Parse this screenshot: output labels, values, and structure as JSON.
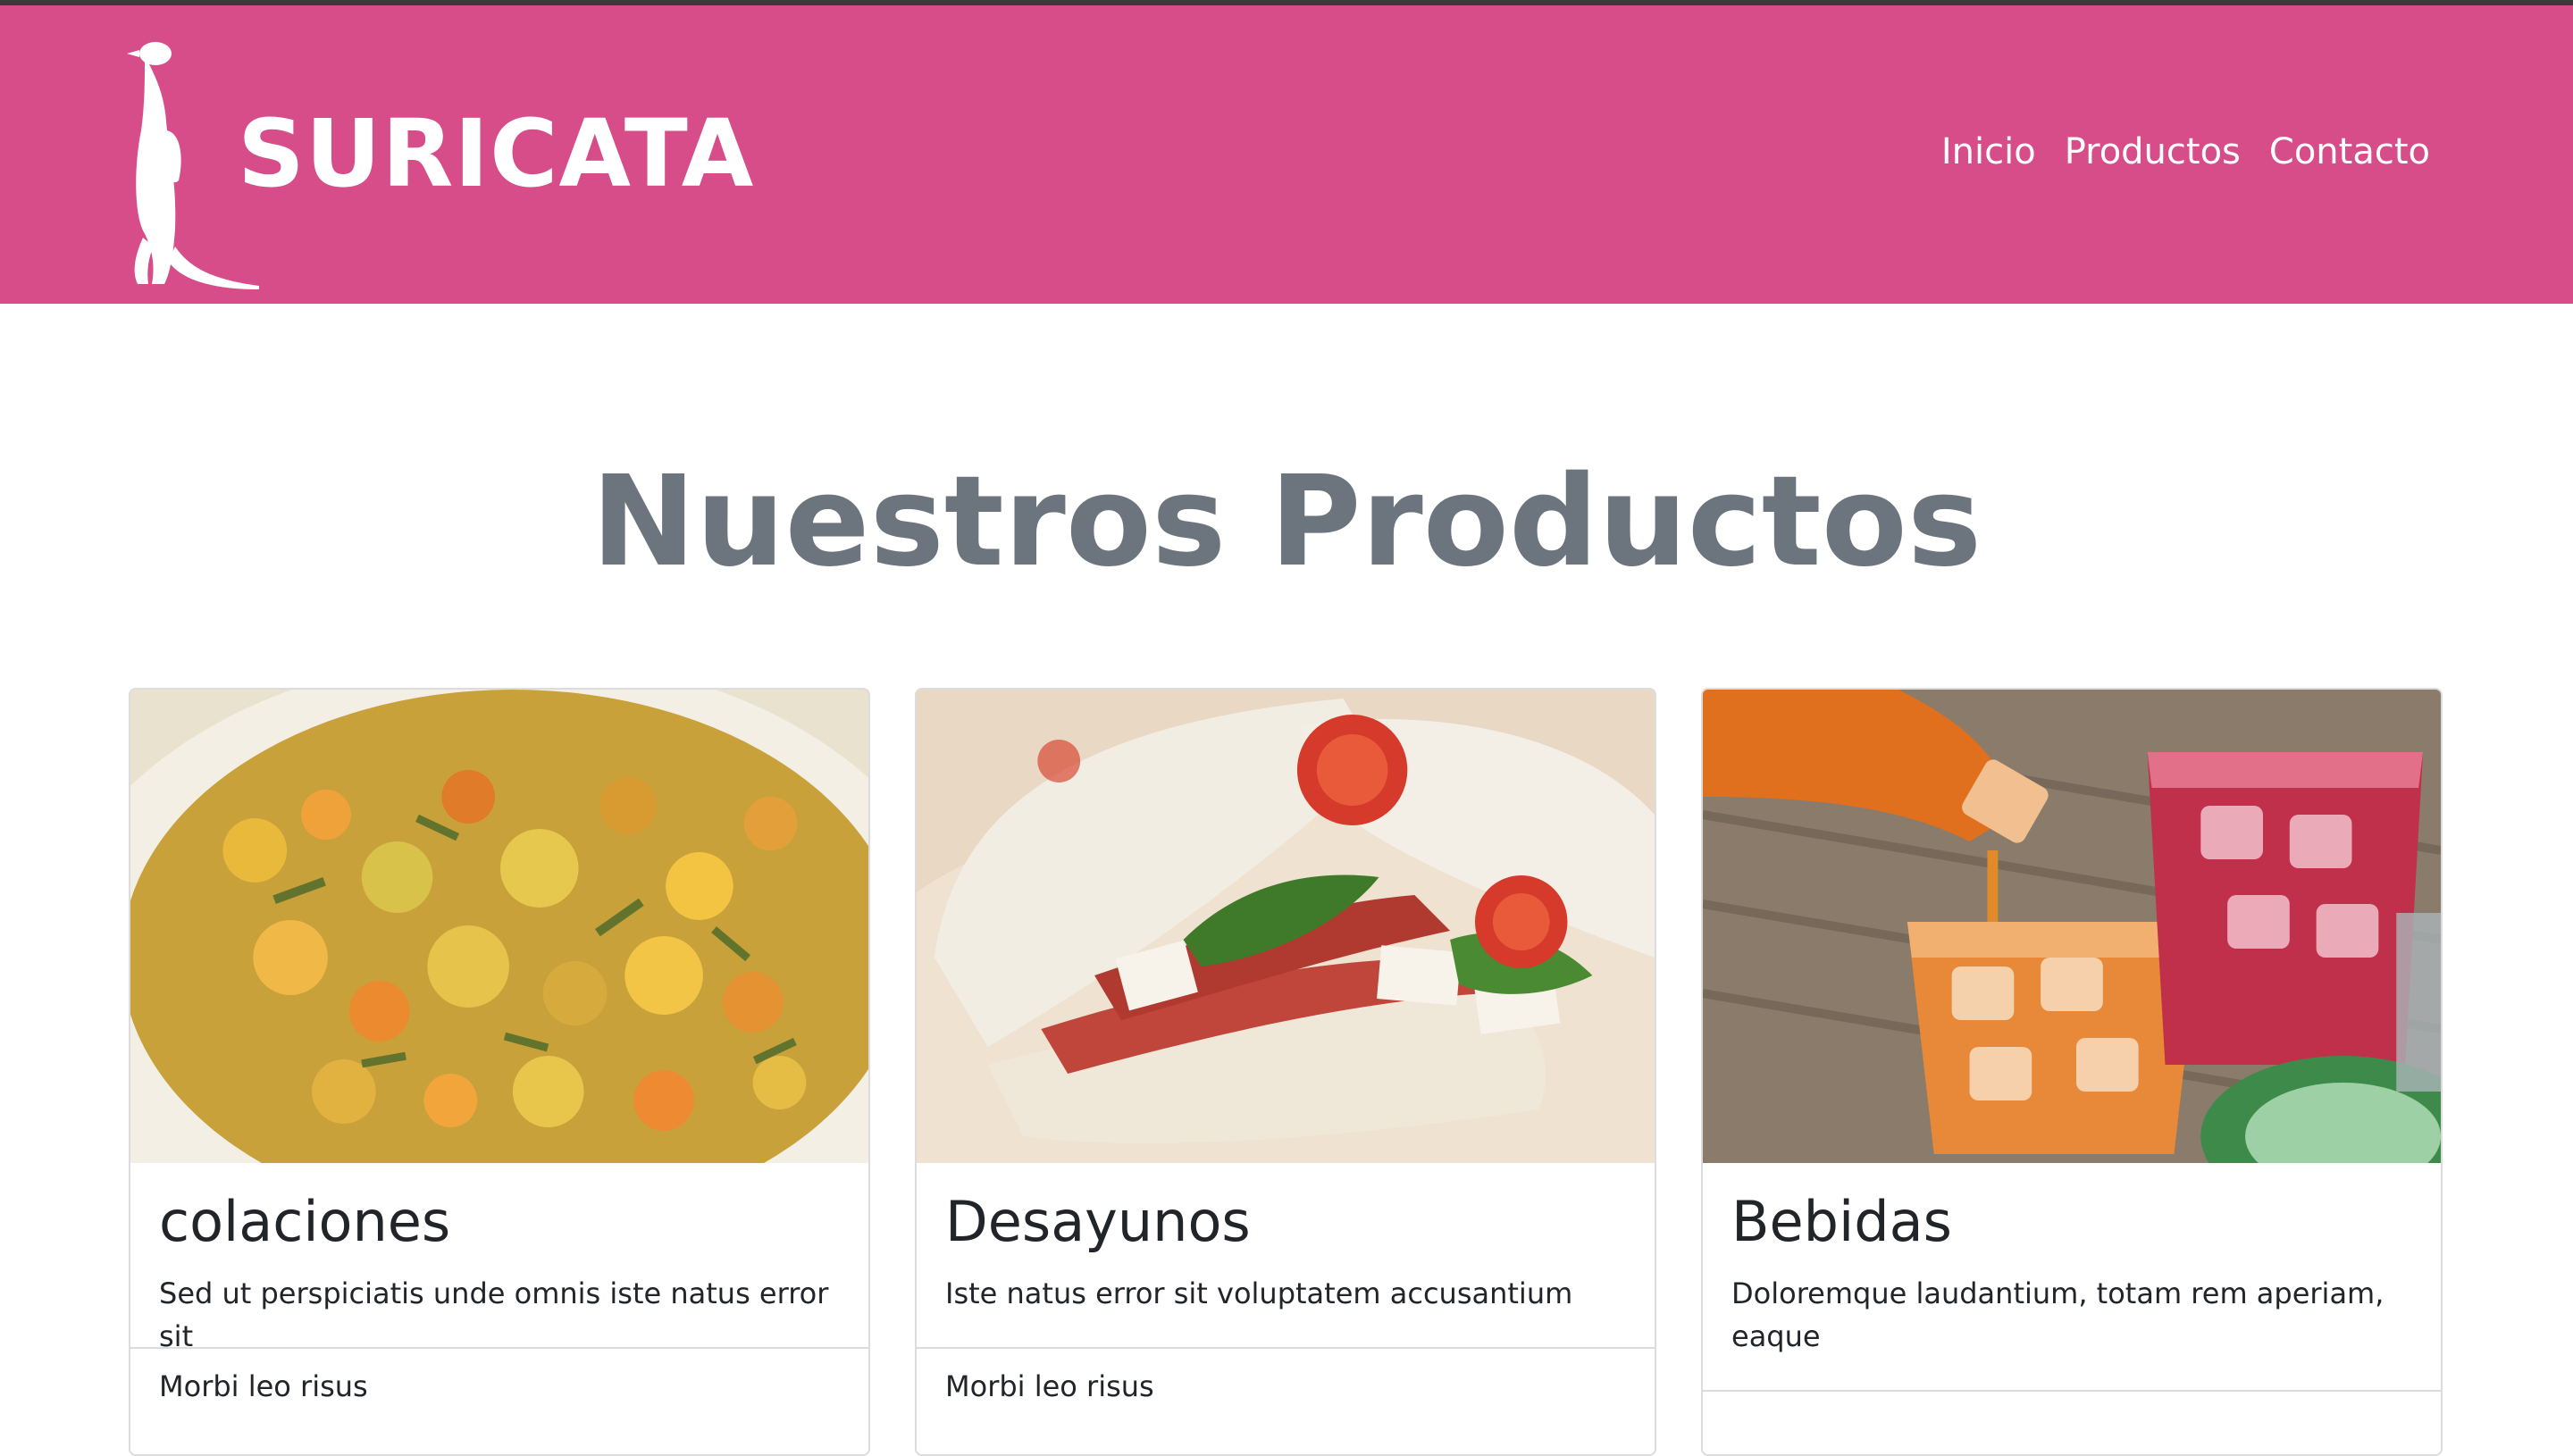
{
  "brand": {
    "name": "SURICATA"
  },
  "nav": {
    "items": [
      "Inicio",
      "Productos",
      "Contacto"
    ]
  },
  "main": {
    "title": "Nuestros Productos",
    "cards": [
      {
        "title": "colaciones",
        "text": "Sed ut perspiciatis unde omnis iste natus error sit",
        "list_item": "Morbi leo risus",
        "image": "food-bowl-image"
      },
      {
        "title": "Desayunos",
        "text": "Iste natus error sit voluptatem accusantium",
        "list_item": "Morbi leo risus",
        "image": "sandwich-image"
      },
      {
        "title": "Bebidas",
        "text": "Doloremque laudantium, totam rem aperiam, eaque",
        "list_item": "",
        "image": "drinks-image"
      }
    ]
  },
  "colors": {
    "navbar": "#d64d8a",
    "title": "#6c757d"
  }
}
